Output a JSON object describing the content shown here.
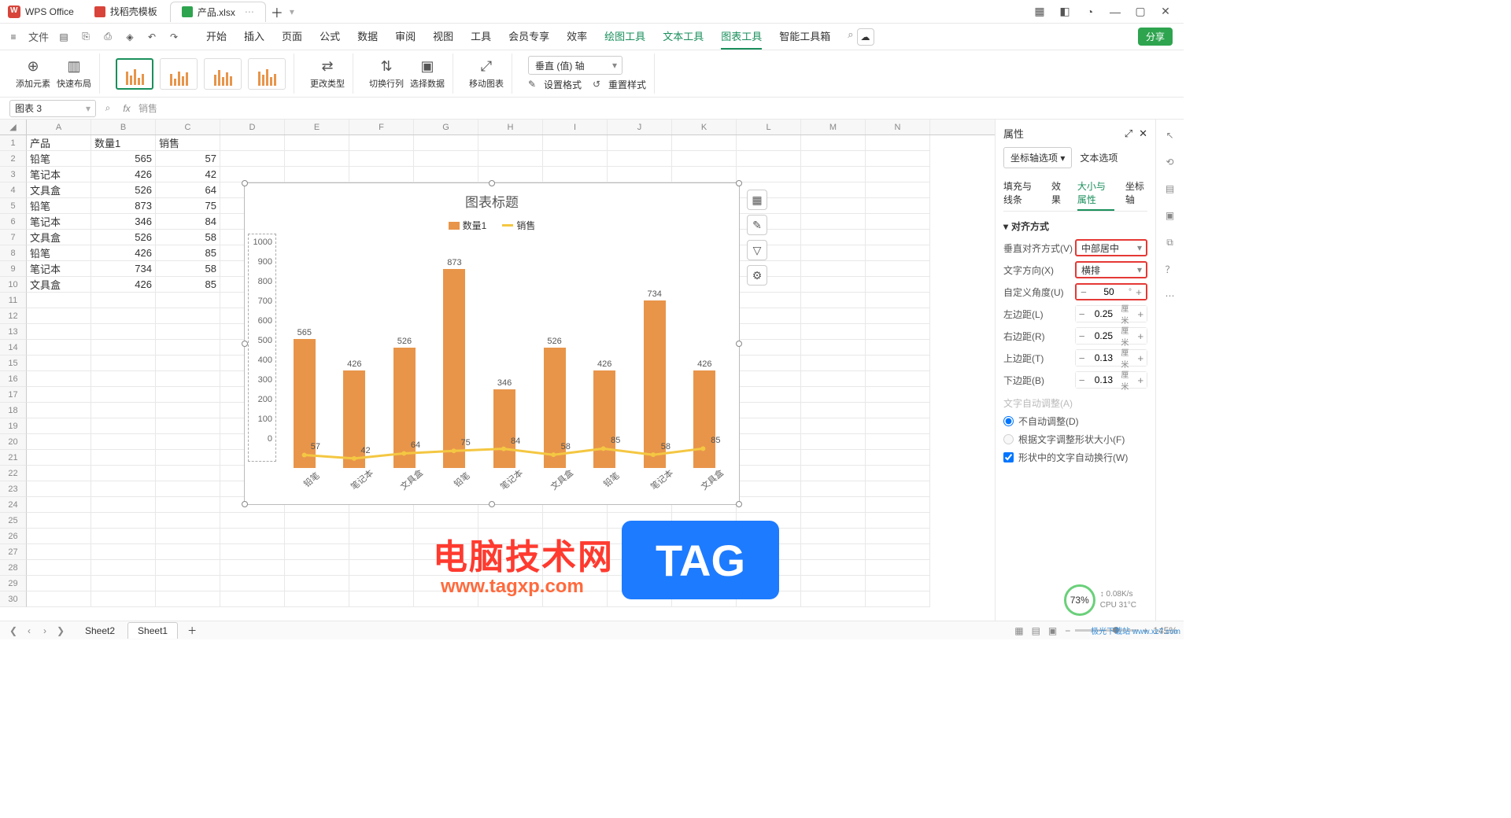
{
  "app": {
    "name": "WPS Office"
  },
  "file_tabs": [
    {
      "icon": "red",
      "label": "找稻壳模板"
    },
    {
      "icon": "green",
      "label": "产品.xlsx",
      "active": true
    }
  ],
  "menu": {
    "file": "文件",
    "tabs": [
      "开始",
      "插入",
      "页面",
      "公式",
      "数据",
      "审阅",
      "视图",
      "工具",
      "会员专享",
      "效率"
    ],
    "tool_tabs": [
      "绘图工具",
      "文本工具",
      "图表工具",
      "智能工具箱"
    ],
    "active_tool": "图表工具",
    "share": "分享"
  },
  "ribbon": {
    "add_element": "添加元素",
    "quick_layout": "快速布局",
    "change_type": "更改类型",
    "switch_rowcol": "切换行列",
    "select_data": "选择数据",
    "move_chart": "移动图表",
    "axis_select": "垂直 (值) 轴",
    "set_format": "设置格式",
    "reset_style": "重置样式"
  },
  "formula": {
    "name_box": "图表 3",
    "text": "销售"
  },
  "columns": [
    "A",
    "B",
    "C",
    "D",
    "E",
    "F",
    "G",
    "H",
    "I",
    "J",
    "K",
    "L",
    "M",
    "N"
  ],
  "table": {
    "headers": {
      "A": "产品",
      "B": "数量1",
      "C": "销售"
    },
    "rows": [
      {
        "A": "铅笔",
        "B": 565,
        "C": 57
      },
      {
        "A": "笔记本",
        "B": 426,
        "C": 42
      },
      {
        "A": "文具盒",
        "B": 526,
        "C": 64
      },
      {
        "A": "铅笔",
        "B": 873,
        "C": 75
      },
      {
        "A": "笔记本",
        "B": 346,
        "C": 84
      },
      {
        "A": "文具盒",
        "B": 526,
        "C": 58
      },
      {
        "A": "铅笔",
        "B": 426,
        "C": 85
      },
      {
        "A": "笔记本",
        "B": 734,
        "C": 58
      },
      {
        "A": "文具盒",
        "B": 426,
        "C": 85
      }
    ]
  },
  "chart_data": {
    "type": "bar",
    "title": "图表标题",
    "categories": [
      "铅笔",
      "笔记本",
      "文具盒",
      "铅笔",
      "笔记本",
      "文具盒",
      "铅笔",
      "笔记本",
      "文具盒"
    ],
    "series": [
      {
        "name": "数量1",
        "type": "bar",
        "color": "#e8954a",
        "values": [
          565,
          426,
          526,
          873,
          346,
          526,
          426,
          734,
          426
        ]
      },
      {
        "name": "销售",
        "type": "line",
        "color": "#f4c742",
        "values": [
          57,
          42,
          64,
          75,
          84,
          58,
          85,
          58,
          85
        ]
      }
    ],
    "ylim": [
      0,
      1000
    ],
    "yticks": [
      1000,
      900,
      800,
      700,
      600,
      500,
      400,
      300,
      200,
      100,
      0
    ],
    "xlabel": "",
    "ylabel": ""
  },
  "panel": {
    "title": "属性",
    "option_tabs": [
      "坐标轴选项",
      "文本选项"
    ],
    "sub_tabs": [
      "填充与线条",
      "效果",
      "大小与属性",
      "坐标轴"
    ],
    "active_sub": "大小与属性",
    "section": "对齐方式",
    "valign_label": "垂直对齐方式(V)",
    "valign_value": "中部居中",
    "dir_label": "文字方向(X)",
    "dir_value": "横排",
    "angle_label": "自定义角度(U)",
    "angle_value": "50",
    "angle_unit": "°",
    "margins": {
      "left": {
        "label": "左边距(L)",
        "value": "0.25",
        "unit": "厘米"
      },
      "right": {
        "label": "右边距(R)",
        "value": "0.25",
        "unit": "厘米"
      },
      "top": {
        "label": "上边距(T)",
        "value": "0.13",
        "unit": "厘米"
      },
      "bottom": {
        "label": "下边距(B)",
        "value": "0.13",
        "unit": "厘米"
      }
    },
    "autofit_label": "文字自动调整(A)",
    "radio_noauto": "不自动调整(D)",
    "radio_shrink": "根据文字调整形状大小(F)",
    "check_wrap": "形状中的文字自动换行(W)"
  },
  "sheets": {
    "list": [
      "Sheet2",
      "Sheet1"
    ],
    "active": "Sheet1"
  },
  "status": {
    "zoom": "145%",
    "perf_pct": "73%",
    "net": "0.08K/s",
    "cpu": "CPU 31°C"
  },
  "watermark": {
    "site_cn": "电脑技术网",
    "site_url": "www.tagxp.com",
    "tag": "TAG",
    "dl": "极光下载站  www.xz7.com"
  }
}
